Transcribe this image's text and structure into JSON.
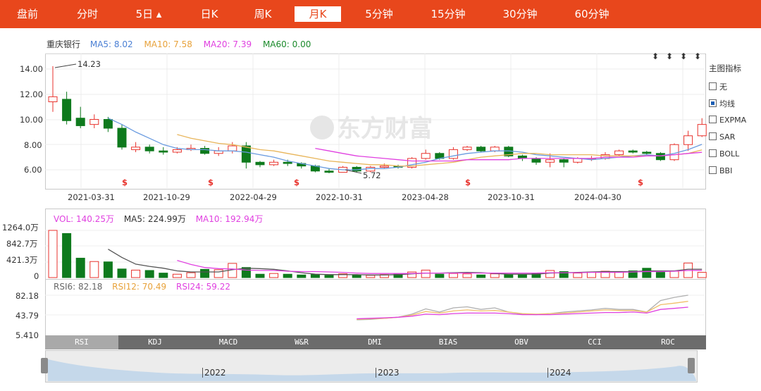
{
  "tabs": [
    {
      "label": "盘前",
      "active": false
    },
    {
      "label": "分时",
      "active": false
    },
    {
      "label": "5日 ▴",
      "active": false
    },
    {
      "label": "日K",
      "active": false
    },
    {
      "label": "周K",
      "active": false
    },
    {
      "label": "月K",
      "active": true
    },
    {
      "label": "5分钟",
      "active": false
    },
    {
      "label": "15分钟",
      "active": false
    },
    {
      "label": "30分钟",
      "active": false
    },
    {
      "label": "60分钟",
      "active": false
    }
  ],
  "stock_name": "重庆银行",
  "ma_legend": [
    {
      "text": "MA5: 8.02",
      "color": "#4a7fd4"
    },
    {
      "text": "MA10: 7.58",
      "color": "#e8a23a"
    },
    {
      "text": "MA20: 7.39",
      "color": "#e040e0"
    },
    {
      "text": "MA60: 0.00",
      "color": "#1a8a2a"
    }
  ],
  "price_axis": [
    "14.00",
    "12.00",
    "10.00",
    "8.00",
    "6.00"
  ],
  "date_axis": [
    "2021-03-31",
    "2021-10-29",
    "2022-04-29",
    "2022-10-31",
    "2023-04-28",
    "2023-10-31",
    "2024-04-30"
  ],
  "high_mark": "14.23",
  "low_mark": "5.72",
  "watermark": "东方财富",
  "indicator_panel": {
    "title": "主图指标",
    "options": [
      {
        "label": "无",
        "checked": false
      },
      {
        "label": "均线",
        "checked": true
      },
      {
        "label": "EXPMA",
        "checked": false
      },
      {
        "label": "SAR",
        "checked": false
      },
      {
        "label": "BOLL",
        "checked": false
      },
      {
        "label": "BBI",
        "checked": false
      }
    ]
  },
  "vol_legend": [
    {
      "text": "VOL: 140.25万",
      "color": "#e040e0"
    },
    {
      "text": "MA5: 224.99万",
      "color": "#333333"
    },
    {
      "text": "MA10: 192.94万",
      "color": "#e040e0"
    }
  ],
  "vol_axis": [
    "1264.0万",
    "842.7万",
    "421.3万",
    "0"
  ],
  "rsi_legend": [
    {
      "text": "RSI6: 82.18",
      "color": "#666666"
    },
    {
      "text": "RSI12: 70.49",
      "color": "#e8a23a"
    },
    {
      "text": "RSI24: 59.22",
      "color": "#e040e0"
    }
  ],
  "rsi_axis": [
    "82.18",
    "43.79",
    "5.410"
  ],
  "indicator_tabs": [
    {
      "label": "RSI",
      "active": true
    },
    {
      "label": "KDJ",
      "active": false
    },
    {
      "label": "MACD",
      "active": false
    },
    {
      "label": "W&R",
      "active": false
    },
    {
      "label": "DMI",
      "active": false
    },
    {
      "label": "BIAS",
      "active": false
    },
    {
      "label": "OBV",
      "active": false
    },
    {
      "label": "CCI",
      "active": false
    },
    {
      "label": "ROC",
      "active": false
    }
  ],
  "navigator_years": [
    "2022",
    "2023",
    "2024"
  ],
  "dividend_marker": "$",
  "arrow_marker": "⬍",
  "colors": {
    "up": "#e8322c",
    "down": "#0e7a1d",
    "accent": "#e8471c"
  },
  "chart_data": {
    "type": "candlestick",
    "y_range": [
      5.0,
      14.8
    ],
    "candles": [
      [
        11.4,
        11.8,
        14.23,
        10.6
      ],
      [
        11.6,
        9.9,
        12.2,
        9.6
      ],
      [
        10.1,
        9.5,
        11.0,
        9.3
      ],
      [
        9.6,
        10.0,
        10.4,
        9.3
      ],
      [
        10.0,
        9.3,
        10.2,
        9.0
      ],
      [
        9.3,
        7.8,
        9.6,
        7.6
      ],
      [
        7.6,
        7.8,
        8.2,
        7.4
      ],
      [
        7.8,
        7.5,
        8.0,
        7.3
      ],
      [
        7.5,
        7.4,
        7.8,
        7.2
      ],
      [
        7.4,
        7.6,
        7.8,
        7.3
      ],
      [
        7.6,
        7.7,
        8.0,
        7.5
      ],
      [
        7.7,
        7.3,
        7.9,
        7.2
      ],
      [
        7.3,
        7.5,
        7.8,
        7.1
      ],
      [
        7.5,
        7.9,
        8.2,
        7.3
      ],
      [
        7.9,
        6.6,
        8.2,
        6.1
      ],
      [
        6.6,
        6.4,
        6.7,
        6.2
      ],
      [
        6.4,
        6.6,
        6.8,
        6.3
      ],
      [
        6.6,
        6.5,
        6.8,
        6.3
      ],
      [
        6.5,
        6.3,
        6.6,
        6.1
      ],
      [
        6.3,
        5.9,
        6.4,
        5.8
      ],
      [
        5.9,
        5.8,
        6.1,
        5.72
      ],
      [
        5.8,
        6.2,
        6.3,
        5.8
      ],
      [
        6.2,
        5.9,
        6.3,
        5.8
      ],
      [
        5.9,
        6.2,
        6.3,
        5.8
      ],
      [
        6.2,
        6.3,
        6.5,
        6.1
      ],
      [
        6.3,
        6.2,
        6.4,
        6.1
      ],
      [
        6.2,
        6.9,
        7.0,
        6.1
      ],
      [
        6.9,
        7.3,
        7.6,
        6.8
      ],
      [
        7.3,
        6.9,
        7.4,
        6.8
      ],
      [
        6.9,
        7.6,
        7.8,
        6.8
      ],
      [
        7.6,
        7.8,
        7.9,
        7.5
      ],
      [
        7.8,
        7.5,
        7.9,
        7.4
      ],
      [
        7.5,
        7.8,
        7.9,
        7.4
      ],
      [
        7.8,
        7.1,
        7.9,
        7.0
      ],
      [
        7.1,
        6.9,
        7.2,
        6.7
      ],
      [
        6.9,
        6.6,
        7.0,
        6.4
      ],
      [
        6.6,
        6.8,
        7.3,
        6.2
      ],
      [
        6.8,
        6.6,
        6.9,
        6.2
      ],
      [
        6.6,
        6.9,
        7.0,
        6.5
      ],
      [
        6.9,
        6.9,
        7.1,
        6.7
      ],
      [
        6.9,
        7.2,
        7.4,
        6.8
      ],
      [
        7.2,
        7.5,
        7.6,
        7.1
      ],
      [
        7.5,
        7.4,
        7.6,
        7.3
      ],
      [
        7.4,
        7.3,
        7.5,
        7.2
      ],
      [
        7.3,
        6.8,
        7.4,
        6.7
      ],
      [
        6.8,
        8.0,
        8.1,
        6.7
      ],
      [
        8.0,
        8.7,
        9.1,
        7.5
      ],
      [
        8.7,
        9.6,
        10.1,
        8.6
      ]
    ],
    "ma5": [
      null,
      null,
      null,
      null,
      10.1,
      9.6,
      9.0,
      8.5,
      8.0,
      7.7,
      7.6,
      7.6,
      7.5,
      7.5,
      7.4,
      7.2,
      7.0,
      6.7,
      6.5,
      6.3,
      6.1,
      6.0,
      6.0,
      6.1,
      6.1,
      6.2,
      6.4,
      6.6,
      6.9,
      7.1,
      7.3,
      7.4,
      7.5,
      7.5,
      7.4,
      7.2,
      7.1,
      7.0,
      6.9,
      6.8,
      6.9,
      7.0,
      7.1,
      7.2,
      7.1,
      7.3,
      7.6,
      8.02
    ],
    "ma10": [
      null,
      null,
      null,
      null,
      null,
      null,
      null,
      null,
      null,
      8.8,
      8.5,
      8.3,
      8.1,
      8.0,
      7.8,
      7.6,
      7.5,
      7.3,
      7.1,
      6.9,
      6.7,
      6.6,
      6.5,
      6.4,
      6.4,
      6.3,
      6.3,
      6.4,
      6.5,
      6.6,
      6.8,
      7.0,
      7.1,
      7.2,
      7.3,
      7.3,
      7.2,
      7.2,
      7.2,
      7.2,
      7.1,
      7.1,
      7.1,
      7.1,
      7.1,
      7.2,
      7.3,
      7.58
    ],
    "ma20": [
      null,
      null,
      null,
      null,
      null,
      null,
      null,
      null,
      null,
      null,
      null,
      null,
      null,
      null,
      null,
      null,
      null,
      null,
      null,
      7.7,
      7.5,
      7.3,
      7.1,
      7.0,
      6.9,
      6.8,
      6.7,
      6.7,
      6.7,
      6.7,
      6.8,
      6.8,
      6.8,
      6.8,
      6.9,
      6.9,
      6.9,
      6.9,
      6.9,
      6.9,
      7.0,
      7.0,
      7.0,
      7.1,
      7.1,
      7.2,
      7.3,
      7.39
    ],
    "volume": [
      1264,
      1180,
      520,
      430,
      420,
      230,
      200,
      190,
      120,
      90,
      130,
      220,
      210,
      380,
      270,
      90,
      110,
      90,
      70,
      80,
      60,
      100,
      70,
      60,
      80,
      90,
      150,
      200,
      90,
      110,
      100,
      70,
      100,
      80,
      90,
      120,
      190,
      160,
      120,
      150,
      170,
      150,
      180,
      250,
      140,
      170,
      390,
      140.25
    ],
    "vol_ma5": [
      null,
      null,
      null,
      null,
      760,
      540,
      360,
      300,
      250,
      180,
      150,
      150,
      150,
      210,
      250,
      240,
      220,
      180,
      130,
      90,
      80,
      80,
      80,
      70,
      70,
      80,
      100,
      120,
      120,
      130,
      140,
      130,
      110,
      90,
      90,
      90,
      120,
      130,
      140,
      150,
      160,
      160,
      160,
      180,
      180,
      180,
      225,
      224.99
    ],
    "vol_ma10": [
      null,
      null,
      null,
      null,
      null,
      null,
      null,
      null,
      null,
      460,
      350,
      270,
      240,
      230,
      200,
      190,
      190,
      170,
      160,
      160,
      150,
      140,
      120,
      110,
      110,
      110,
      110,
      120,
      120,
      120,
      120,
      120,
      120,
      120,
      120,
      120,
      130,
      130,
      130,
      140,
      140,
      140,
      150,
      160,
      160,
      170,
      190,
      192.94
    ],
    "rsi6": [
      null,
      null,
      null,
      null,
      null,
      null,
      null,
      null,
      null,
      null,
      null,
      null,
      null,
      null,
      null,
      null,
      null,
      null,
      null,
      null,
      null,
      null,
      35,
      36,
      38,
      40,
      46,
      56,
      50,
      58,
      60,
      55,
      58,
      50,
      46,
      45,
      47,
      50,
      52,
      54,
      57,
      55,
      55,
      50,
      72,
      78,
      82.18
    ],
    "rsi12": [
      null,
      null,
      null,
      null,
      null,
      null,
      null,
      null,
      null,
      null,
      null,
      null,
      null,
      null,
      null,
      null,
      null,
      null,
      null,
      null,
      null,
      null,
      36,
      37,
      38,
      40,
      44,
      51,
      48,
      52,
      54,
      52,
      53,
      50,
      47,
      46,
      47,
      48,
      50,
      52,
      54,
      53,
      53,
      50,
      64,
      67,
      70.49
    ],
    "rsi24": [
      null,
      null,
      null,
      null,
      null,
      null,
      null,
      null,
      null,
      null,
      null,
      null,
      null,
      null,
      null,
      null,
      null,
      null,
      null,
      null,
      null,
      null,
      37,
      38,
      39,
      40,
      42,
      46,
      45,
      47,
      48,
      48,
      48,
      47,
      45,
      45,
      45,
      46,
      47,
      48,
      49,
      49,
      50,
      48,
      55,
      57,
      59.22
    ],
    "rsi_range": [
      5.41,
      82.18
    ],
    "vol_range": [
      0,
      1264.0
    ]
  }
}
